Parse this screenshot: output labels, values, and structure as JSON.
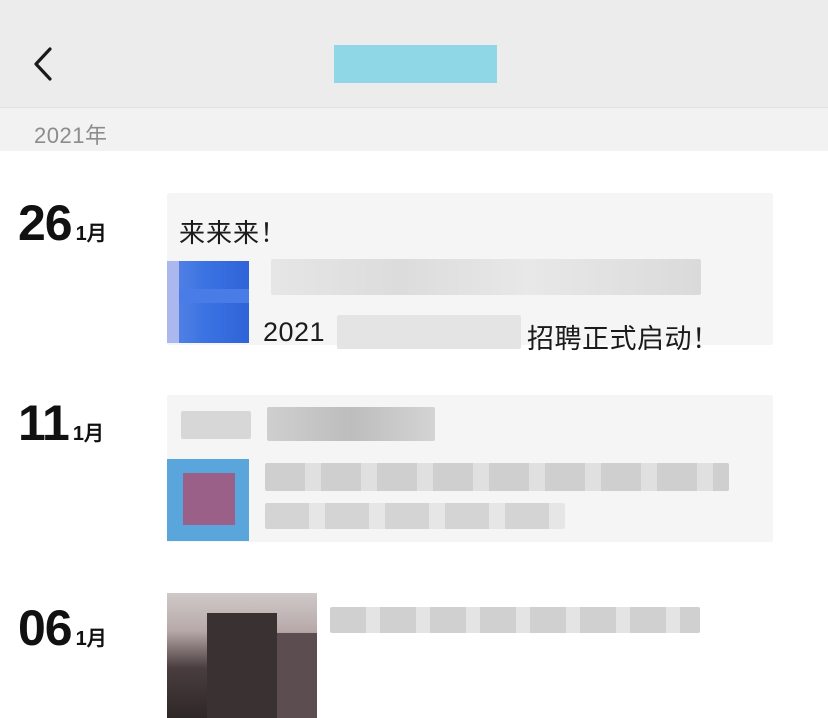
{
  "header": {
    "back_icon": "chevron-left-icon",
    "title_redaction_color": "#8fd6e6"
  },
  "year_label": "2021年",
  "entries": [
    {
      "day": "26",
      "month": "1月",
      "comment": "来来来！",
      "share_line_start": "2021",
      "share_line_end": "招聘正式启动！"
    },
    {
      "day": "11",
      "month": "1月"
    },
    {
      "day": "06",
      "month": "1月"
    }
  ],
  "colors": {
    "header_bg": "#ececec",
    "year_strip_bg": "#f2f2f2",
    "card_bg": "#f5f5f5",
    "redaction_blue": "#3f7be0"
  }
}
